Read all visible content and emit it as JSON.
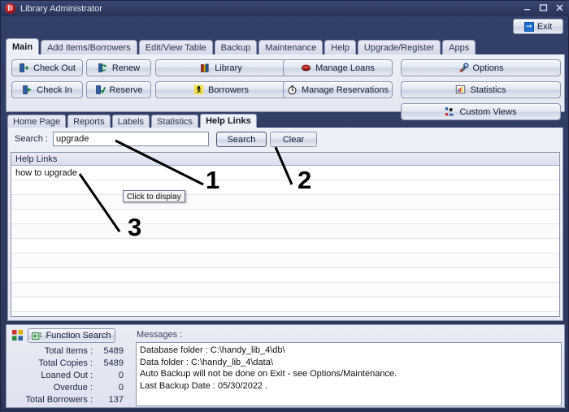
{
  "window": {
    "title": "Library Administrator",
    "app_icon": "D",
    "controls": {
      "minimize": "minimize-icon",
      "maximize": "maximize-icon",
      "close": "close-icon"
    },
    "exit_button": "Exit"
  },
  "main_tabs": [
    {
      "label": "Main",
      "active": true
    },
    {
      "label": "Add Items/Borrowers",
      "active": false
    },
    {
      "label": "Edit/View Table",
      "active": false
    },
    {
      "label": "Backup",
      "active": false
    },
    {
      "label": "Maintenance",
      "active": false
    },
    {
      "label": "Help",
      "active": false
    },
    {
      "label": "Upgrade/Register",
      "active": false
    },
    {
      "label": "Apps",
      "active": false
    }
  ],
  "toolbar": {
    "check_out": "Check Out",
    "renew": "Renew",
    "library": "Library",
    "check_in": "Check In",
    "reserve": "Reserve",
    "borrowers": "Borrowers",
    "manage_loans": "Manage Loans",
    "manage_reservations": "Manage Reservations",
    "options": "Options",
    "statistics": "Statistics",
    "custom_views": "Custom Views"
  },
  "sub_tabs": [
    {
      "label": "Home Page",
      "active": false
    },
    {
      "label": "Reports",
      "active": false
    },
    {
      "label": "Labels",
      "active": false
    },
    {
      "label": "Statistics",
      "active": false
    },
    {
      "label": "Help Links",
      "active": true
    }
  ],
  "search": {
    "label": "Search :",
    "value": "upgrade",
    "placeholder": "",
    "search_button": "Search",
    "clear_button": "Clear"
  },
  "grid": {
    "header": "Help Links",
    "rows": [
      "how to upgrade"
    ],
    "empty_row_count": 10
  },
  "tooltip": {
    "text": "Click to display"
  },
  "bottom": {
    "function_search": "Function Search",
    "messages_label": "Messages :",
    "stats": [
      {
        "label": "Total Items :",
        "value": "5489"
      },
      {
        "label": "Total Copies :",
        "value": "5489"
      },
      {
        "label": "Loaned Out :",
        "value": "0"
      },
      {
        "label": "Overdue :",
        "value": "0"
      },
      {
        "label": "Total Borrowers :",
        "value": "137"
      }
    ],
    "messages": [
      "Database folder : C:\\handy_lib_4\\db\\",
      "Data folder : C:\\handy_lib_4\\data\\",
      "Auto Backup will not be done on Exit - see Options/Maintenance.",
      "Last Backup Date : 05/30/2022 ."
    ]
  },
  "annotations": [
    {
      "number": "1"
    },
    {
      "number": "2"
    },
    {
      "number": "3"
    }
  ],
  "colors": {
    "window_chrome": "#2e3a5c",
    "panel": "#eef0f7",
    "accent": "#1c6fd0",
    "annotation": "#000000"
  }
}
